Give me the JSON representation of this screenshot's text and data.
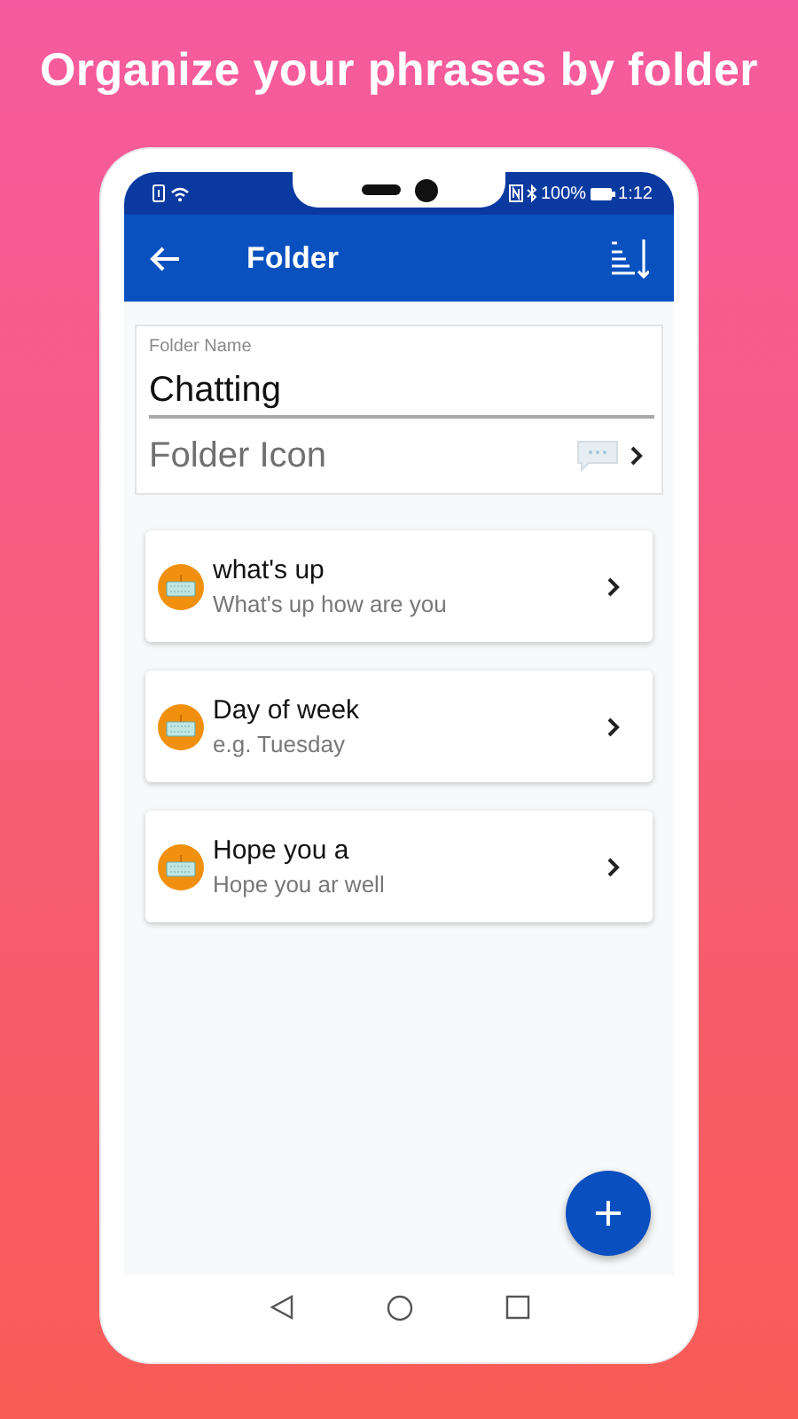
{
  "headline": "Organize your phrases by folder",
  "status_bar": {
    "battery": "100%",
    "time": "1:12"
  },
  "app_bar": {
    "title": "Folder"
  },
  "folder_form": {
    "name_label": "Folder Name",
    "name_value": "Chatting",
    "icon_label": "Folder Icon"
  },
  "phrases": [
    {
      "title": "what's up",
      "subtitle": "What's up how are you"
    },
    {
      "title": "Day of week",
      "subtitle": "e.g. Tuesday"
    },
    {
      "title": "Hope you a",
      "subtitle": "Hope you ar well"
    }
  ]
}
